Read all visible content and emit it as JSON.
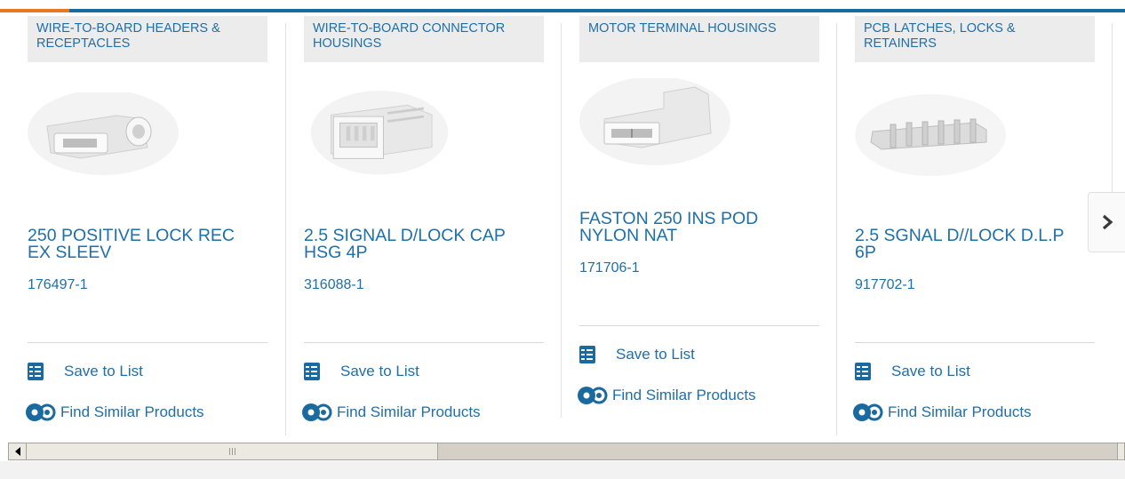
{
  "colors": {
    "accent": "#e87722",
    "brand": "#1a6aa0",
    "link": "#1f6fa8"
  },
  "products": [
    {
      "category": "WIRE-TO-BOARD HEADERS & RECEPTACLES",
      "title": "250 POSITIVE LOCK REC EX SLEEV",
      "part_number": "176497-1",
      "image_icon": "receptacle-image"
    },
    {
      "category": "WIRE-TO-BOARD CONNECTOR HOUSINGS",
      "title": "2.5 SIGNAL D/LOCK CAP HSG 4P",
      "part_number": "316088-1",
      "image_icon": "housing-image"
    },
    {
      "category": "MOTOR TERMINAL HOUSINGS",
      "title": "FASTON 250 INS POD NYLON NAT",
      "part_number": "171706-1",
      "image_icon": "terminal-housing-image"
    },
    {
      "category": "PCB LATCHES, LOCKS & RETAINERS",
      "title": "2.5 SGNAL D//LOCK D.L.P 6P",
      "part_number": "917702-1",
      "image_icon": "latch-image"
    }
  ],
  "actions": {
    "save_label": "Save to List",
    "similar_label": "Find Similar Products"
  },
  "icons": {
    "save": "checklist-icon",
    "similar": "gears-icon",
    "next": "chevron-right-icon"
  }
}
